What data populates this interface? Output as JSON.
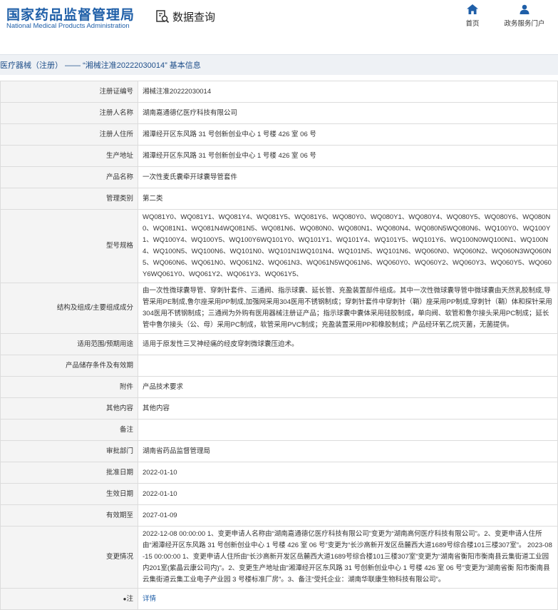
{
  "header": {
    "logo_cn": "国家药品监督管理局",
    "logo_en": "National Medical Products Administration",
    "query_label": "数据查询",
    "nav_home": "首页",
    "nav_service": "政务服务门户",
    "accent": "#1f5fa8"
  },
  "title": "医疗器械（注册） —— “湘械注准20222030014” 基本信息",
  "rows": [
    {
      "label": "注册证编号",
      "value": "湘械注准20222030014"
    },
    {
      "label": "注册人名称",
      "value": "湖南嘉通德亿医疗科技有限公司"
    },
    {
      "label": "注册人住所",
      "value": "湘潭经开区东风路 31 号创新创业中心 1 号楼 426 室 06 号"
    },
    {
      "label": "生产地址",
      "value": "湘潭经开区东风路 31 号创新创业中心 1 号楼 426 室 06 号"
    },
    {
      "label": "产品名称",
      "value": "一次性麦氏囊牵开球囊导管套件"
    },
    {
      "label": "管理类别",
      "value": "第二类"
    },
    {
      "label": "型号规格",
      "value": "WQ081Y0、WQ081Y1、WQ081Y4、WQ081Y5、WQ081Y6、WQ080Y0、WQ080Y1、WQ080Y4、WQ080Y5、WQ080Y6、WQ080N0、WQ081N1、WQ081N4WQ081N5、WQ081N6、WQ080N0、WQ080N1、WQ080N4、WQ080N5WQ080N6、WQ100Y0、WQ100Y1、WQ100Y4、WQ100Y5、WQ100Y6WQ101Y0、WQ101Y1、WQ101Y4、WQ101Y5、WQ101Y6、WQ100N0WQ100N1、WQ100N4、WQ100N5、WQ100N6、WQ101N0、WQ101N1WQ101N4、WQ101N5、WQ101N6、WQ060N0、WQ060N2、WQ060N3WQ060N5、WQ060N6、WQ061N0、WQ061N2、WQ061N3、WQ061N5WQ061N6、WQ060Y0、WQ060Y2、WQ060Y3、WQ060Y5、WQ060Y6WQ061Y0、WQ061Y2、WQ061Y3、WQ061Y5、"
    },
    {
      "label": "结构及组成/主要组成成分",
      "value": "由一次性微球囊导管、穿刺针套件、三通阀、指示球囊、延长管、充盈装置部件组成。其中一次性微球囊导管中微球囊由天然乳胶制成,导管采用PE制成,鲁尔座采用PP制成,加强网采用304医用不锈钢制成；穿刺针套件中穿刺针（鞘）座采用PP制成,穿刺针（鞘）体和探针采用304医用不锈钢制成；三通阀为外购有医用器械注册证产品；指示球囊中囊体采用硅胶制成，单向阀、软管和鲁尔接头采用PC制成；延长管中鲁尔接头（公、母）采用PC制成，软管采用PVC制成；充盈装置采用PP和橡胶制成；产品经环氧乙烷灭菌，无菌提供。"
    },
    {
      "label": "适用范围/预期用途",
      "value": "适用于原发性三叉神经痛的经皮穿刺微球囊压迫术。"
    },
    {
      "label": "产品储存条件及有效期",
      "value": ""
    },
    {
      "label": "附件",
      "value": "产品技术要求"
    },
    {
      "label": "其他内容",
      "value": "其他内容"
    },
    {
      "label": "备注",
      "value": ""
    },
    {
      "label": "审批部门",
      "value": "湖南省药品监督管理局"
    },
    {
      "label": "批准日期",
      "value": "2022-01-10"
    },
    {
      "label": "生效日期",
      "value": "2022-01-10"
    },
    {
      "label": "有效期至",
      "value": "2027-01-09"
    },
    {
      "label": "变更情况",
      "value": "2022-12-08 00:00:00 1、变更申请人名称由“湖南嘉通德亿医疗科技有限公司”变更为“湖南高何医疗科技有限公司”。2、变更申请人住所由“湘潭经开区东风路 31 号创新创业中心 1 号楼 426 室 06 号”变更为“长沙高新开发区岳麓西大道1689号综合楼101三楼307室”。 2023-08-15 00:00:00 1、变更申请人住所由“长沙高新开发区岳麓西大道1689号综合楼101三楼307室”变更为“湖南省衡阳市衡南县云集街道工业园内201室(紫晶云康公司内)”。2、变更生产地址由“湘潭经开区东风路 31 号创新创业中心 1 号楼 426 室 06 号”变更为“湖南省衡 阳市衡南县云集街道云集工业电子产业园 3 号楼标准厂房”。3、备注“受托企业：湖南华联康生物科技有限公司”。"
    }
  ],
  "note": {
    "label": "注",
    "link": "详情"
  }
}
